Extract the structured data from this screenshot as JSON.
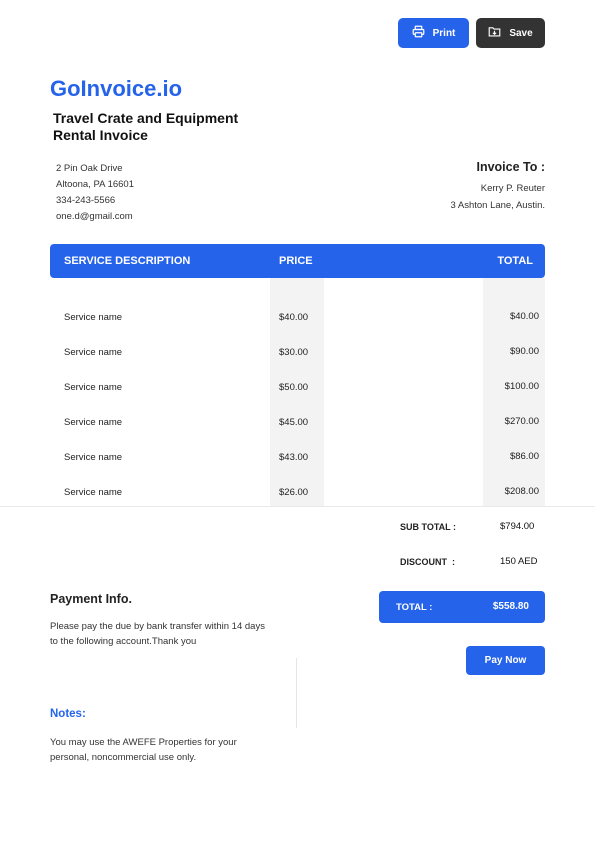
{
  "toolbar": {
    "print_label": "Print",
    "save_label": "Save",
    "print_icon": "printer-icon",
    "save_icon": "download-folder-icon"
  },
  "brand": {
    "name": "GoInvoice.io",
    "color": "#2563eb"
  },
  "document": {
    "title": "Travel Crate and Equipment Rental Invoice"
  },
  "sender": {
    "address_line1": "2 Pin Oak Drive",
    "address_line2": "Altoona, PA 16601",
    "phone": "334-243-5566",
    "email": "one.d@gmail.com"
  },
  "recipient": {
    "label": "Invoice To :",
    "name": "Kerry P. Reuter",
    "address": "3 Ashton Lane, Austin."
  },
  "table": {
    "headers": {
      "description": "SERVICE DESCRIPTION",
      "price": "PRICE",
      "total": "TOTAL"
    },
    "rows": [
      {
        "description": "Service name",
        "price": "$40.00",
        "total": "$40.00"
      },
      {
        "description": "Service name",
        "price": "$30.00",
        "total": "$90.00"
      },
      {
        "description": "Service name",
        "price": "$50.00",
        "total": "$100.00"
      },
      {
        "description": "Service name",
        "price": "$45.00",
        "total": "$270.00"
      },
      {
        "description": "Service name",
        "price": "$43.00",
        "total": "$86.00"
      },
      {
        "description": "Service name",
        "price": "$26.00",
        "total": "$208.00"
      }
    ]
  },
  "summary": {
    "subtotal_label": "SUB TOTAL :",
    "subtotal_value": "$794.00",
    "discount_label": "DISCOUNT  :",
    "discount_value": "150 AED",
    "total_label": "TOTAL :",
    "total_value": "$558.80",
    "pay_button": "Pay Now"
  },
  "payment": {
    "title": "Payment Info.",
    "text": "Please pay the due by bank transfer within 14 days to the following account.Thank you"
  },
  "notes": {
    "title": "Notes:",
    "text": "You may use the AWEFE Properties for your personal, noncommercial use only."
  }
}
